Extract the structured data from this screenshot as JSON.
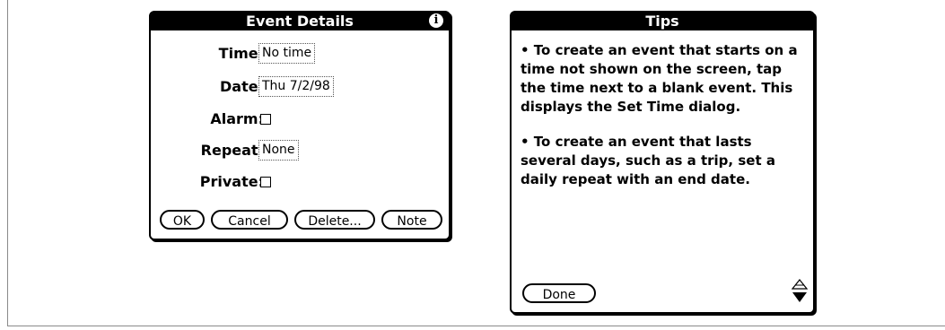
{
  "event_details": {
    "title": "Event Details",
    "info_icon": "info-icon",
    "fields": {
      "time": {
        "label": "Time:",
        "value": "No time"
      },
      "date": {
        "label": "Date:",
        "value": "Thu 7/2/98"
      },
      "alarm": {
        "label": "Alarm:",
        "checked": false
      },
      "repeat": {
        "label": "Repeat:",
        "value": "None"
      },
      "private": {
        "label": "Private:",
        "checked": false
      }
    },
    "buttons": {
      "ok": "OK",
      "cancel": "Cancel",
      "delete": "Delete...",
      "note": "Note"
    }
  },
  "tips": {
    "title": "Tips",
    "paragraph_1": "• To create an event that starts on a time not shown on the screen, tap the time next to a blank event.  This displays the Set Time dialog.",
    "paragraph_2": "• To create an event that lasts several days, such as a trip, set a daily repeat with an end date.",
    "done_label": "Done",
    "scroll_icon": "scroll-arrows-icon"
  }
}
